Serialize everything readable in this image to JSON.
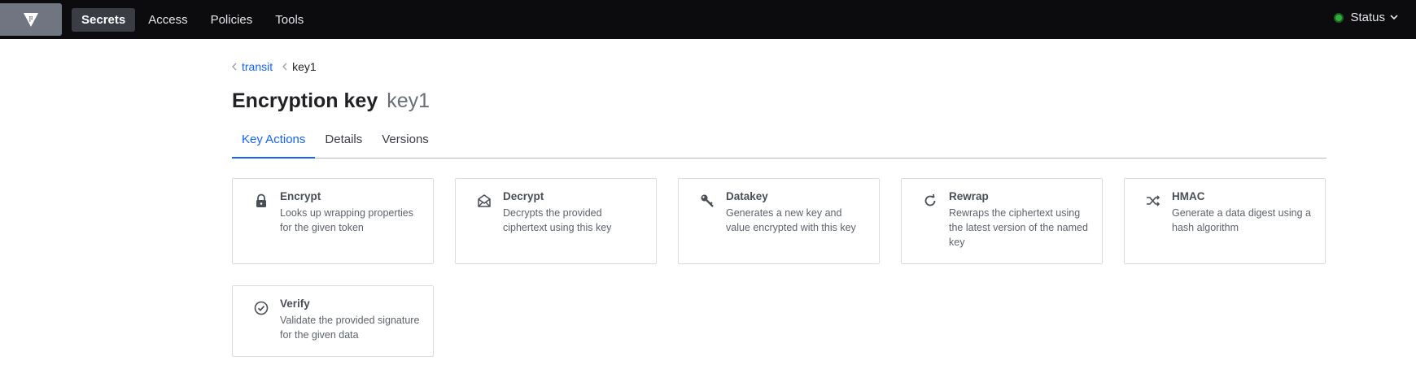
{
  "nav": {
    "items": [
      {
        "label": "Secrets",
        "active": true
      },
      {
        "label": "Access",
        "active": false
      },
      {
        "label": "Policies",
        "active": false
      },
      {
        "label": "Tools",
        "active": false
      }
    ],
    "status_label": "Status",
    "status_color": "#2eb039"
  },
  "breadcrumb": {
    "parent": "transit",
    "current": "key1"
  },
  "header": {
    "title": "Encryption key",
    "key_name": "key1"
  },
  "tabs": [
    {
      "label": "Key Actions",
      "active": true
    },
    {
      "label": "Details",
      "active": false
    },
    {
      "label": "Versions",
      "active": false
    }
  ],
  "actions": [
    {
      "title": "Encrypt",
      "description": "Looks up wrapping properties for the given token",
      "icon": "lock-icon"
    },
    {
      "title": "Decrypt",
      "description": "Decrypts the provided ciphertext using this key",
      "icon": "envelope-open-icon"
    },
    {
      "title": "Datakey",
      "description": "Generates a new key and value encrypted with this key",
      "icon": "key-icon"
    },
    {
      "title": "Rewrap",
      "description": "Rewraps the ciphertext using the latest version of the named key",
      "icon": "rotate-icon"
    },
    {
      "title": "HMAC",
      "description": "Generate a data digest using a hash algorithm",
      "icon": "shuffle-icon"
    },
    {
      "title": "Verify",
      "description": "Validate the provided signature for the given data",
      "icon": "check-circle-icon"
    }
  ],
  "colors": {
    "accent": "#1563ff",
    "topbar": "#0c0c0e"
  }
}
